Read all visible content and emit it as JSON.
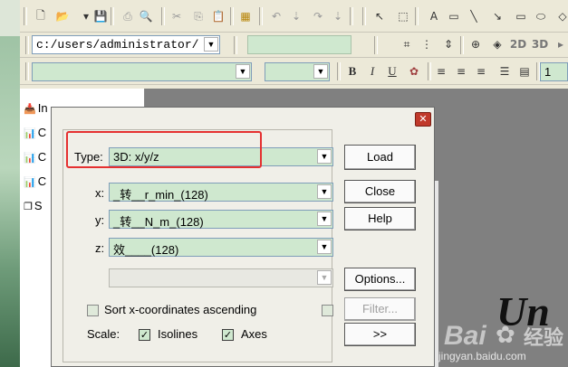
{
  "toolbar1": {
    "icons": [
      "new-file-icon",
      "open-folder-icon",
      "dropdown-arrow-icon",
      "save-icon",
      "print-icon",
      "print-preview-icon",
      "cut-icon",
      "copy-icon",
      "paste-icon",
      "calculator-icon",
      "undo-icon",
      "download-icon",
      "redo-icon",
      "download-icon",
      "pointer-icon",
      "select-rect-icon",
      "text-icon",
      "rectangle-icon",
      "line-icon",
      "arrow-line-icon",
      "rect-shape-icon",
      "ellipse-icon",
      "diamond-icon"
    ],
    "text_tool": "A"
  },
  "toolbar2": {
    "path_value": "c:/users/administrator/",
    "view_2d": "2D",
    "view_3d": "3D"
  },
  "toolbar3": {
    "bold": "B",
    "italic": "I",
    "underline": "U",
    "size_value": "1"
  },
  "left_panel": {
    "items": [
      "In",
      "C",
      "C",
      "C",
      "S"
    ]
  },
  "dialog": {
    "type_label": "Type:",
    "type_value": "3D: x/y/z",
    "x_label": "x:",
    "x_value": "_转__r_min_(128)",
    "y_label": "y:",
    "y_value": "_转__N_m_(128)",
    "z_label": "z:",
    "z_value": "效____(128)",
    "empty_value": "",
    "buttons": {
      "load": "Load",
      "close": "Close",
      "help": "Help",
      "options": "Options...",
      "filter": "Filter...",
      "expand": ">>"
    },
    "sort_label": "Sort x-coordinates ascending",
    "scale_label": "Scale:",
    "isolines_label": "Isolines",
    "axes_label": "Axes",
    "checkbox_mark": "✓"
  },
  "overlay": {
    "watermark_brand": "Bai",
    "watermark_site": "jingyan.baidu.com",
    "watermark_text": "经验",
    "script_text": "Un"
  },
  "colors": {
    "field_green": "#cfe8cf",
    "highlight_red": "#e53030",
    "workspace_gray": "#808080"
  }
}
